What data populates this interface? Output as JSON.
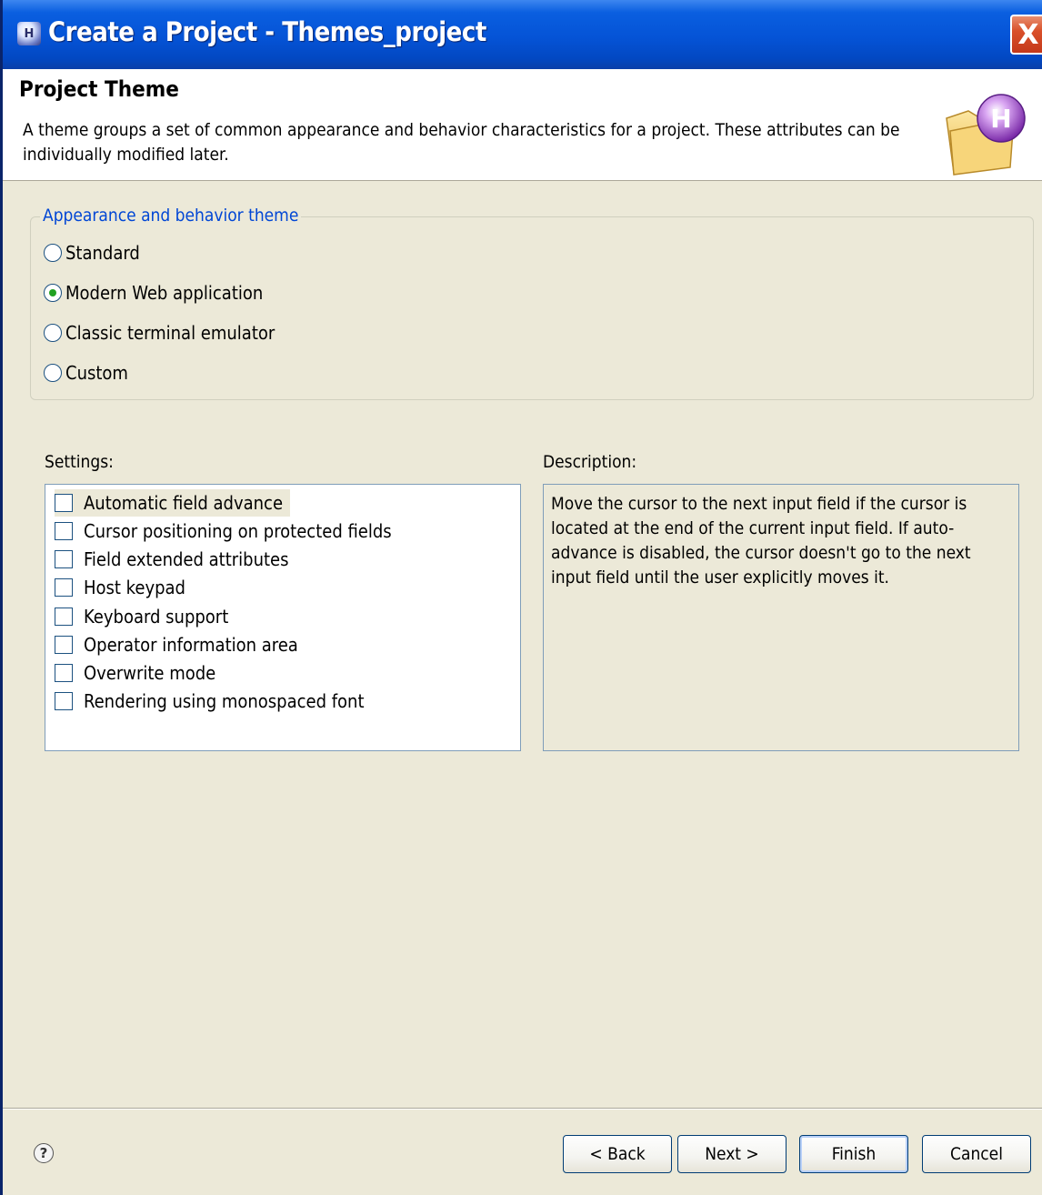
{
  "window": {
    "title": "Create a Project - Themes_project",
    "app_icon_glyph": "H",
    "close_glyph": "X"
  },
  "header": {
    "title": "Project Theme",
    "description": "A theme groups a set of common appearance and behavior characteristics for a project. These attributes can be individually modified later.",
    "image_icon": "folder-h-icon"
  },
  "theme_group": {
    "legend": "Appearance and behavior theme",
    "options": [
      {
        "label": "Standard",
        "selected": false
      },
      {
        "label": "Modern Web application",
        "selected": true
      },
      {
        "label": "Classic terminal emulator",
        "selected": false
      },
      {
        "label": "Custom",
        "selected": false
      }
    ]
  },
  "settings": {
    "label": "Settings:",
    "items": [
      {
        "label": "Automatic field advance",
        "checked": false
      },
      {
        "label": "Cursor positioning on protected fields",
        "checked": false
      },
      {
        "label": "Field extended attributes",
        "checked": false
      },
      {
        "label": "Host keypad",
        "checked": false
      },
      {
        "label": "Keyboard support",
        "checked": false
      },
      {
        "label": "Operator information area",
        "checked": false
      },
      {
        "label": "Overwrite mode",
        "checked": false
      },
      {
        "label": "Rendering using monospaced font",
        "checked": false
      }
    ]
  },
  "description": {
    "label": "Description:",
    "text": "Move the cursor to the next input field if the cursor is located at the end of the current input field. If auto-advance is disabled, the cursor doesn't go to the next input field until the user explicitly moves it."
  },
  "buttons": {
    "help_glyph": "?",
    "back": "< Back",
    "next": "Next >",
    "finish": "Finish",
    "cancel": "Cancel"
  }
}
